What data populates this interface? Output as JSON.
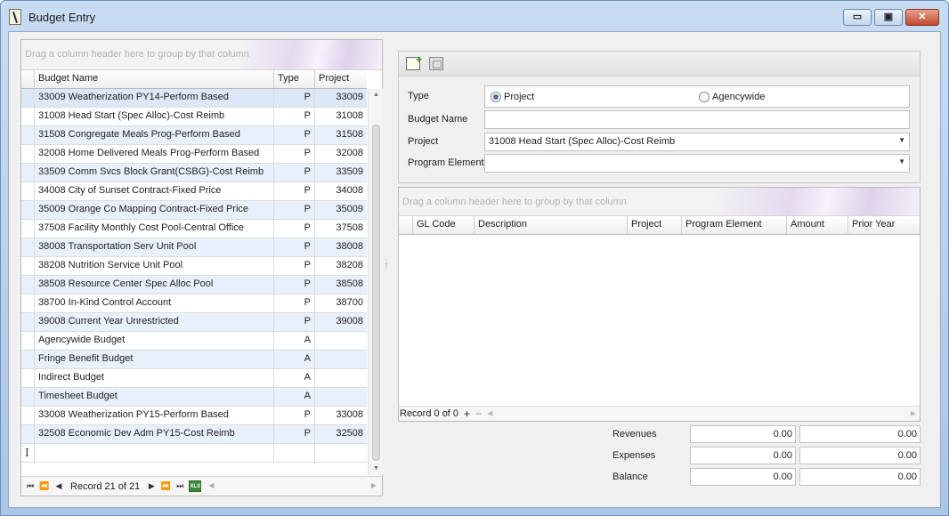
{
  "window": {
    "title": "Budget Entry",
    "buttons": {
      "minimize": "▭",
      "maximize": "▣",
      "close": "✕"
    }
  },
  "left_grid": {
    "group_hint": "Drag a column header here to group by that column",
    "columns": [
      "Budget Name",
      "Type",
      "Project"
    ],
    "rows": [
      {
        "name": "33009 Weatherization  PY14-Perform Based",
        "type": "P",
        "project": "33009"
      },
      {
        "name": "31008 Head Start (Spec Alloc)-Cost Reimb",
        "type": "P",
        "project": "31008"
      },
      {
        "name": "31508 Congregate Meals Prog-Perform Based",
        "type": "P",
        "project": "31508"
      },
      {
        "name": "32008 Home Delivered Meals Prog-Perform Based",
        "type": "P",
        "project": "32008"
      },
      {
        "name": "33509 Comm Svcs Block Grant(CSBG)-Cost Reimb",
        "type": "P",
        "project": "33509"
      },
      {
        "name": "34008 City of Sunset Contract-Fixed Price",
        "type": "P",
        "project": "34008"
      },
      {
        "name": "35009 Orange Co Mapping Contract-Fixed Price",
        "type": "P",
        "project": "35009"
      },
      {
        "name": "37508 Facility Monthly Cost Pool-Central Office",
        "type": "P",
        "project": "37508"
      },
      {
        "name": "38008 Transportation Serv Unit Pool",
        "type": "P",
        "project": "38008"
      },
      {
        "name": "38208 Nutrition Service Unit Pool",
        "type": "P",
        "project": "38208"
      },
      {
        "name": "38508 Resource Center Spec Alloc Pool",
        "type": "P",
        "project": "38508"
      },
      {
        "name": "38700 In-Kind Control Account",
        "type": "P",
        "project": "38700"
      },
      {
        "name": "39008 Current Year Unrestricted",
        "type": "P",
        "project": "39008"
      },
      {
        "name": "Agencywide Budget",
        "type": "A",
        "project": ""
      },
      {
        "name": "Fringe Benefit Budget",
        "type": "A",
        "project": ""
      },
      {
        "name": "Indirect Budget",
        "type": "A",
        "project": ""
      },
      {
        "name": "Timesheet Budget",
        "type": "A",
        "project": ""
      },
      {
        "name": "33008 Weatherization PY15-Perform Based",
        "type": "P",
        "project": "33008"
      },
      {
        "name": "32508 Economic Dev Adm PY15-Cost Reimb",
        "type": "P",
        "project": "32508"
      }
    ],
    "navigator": {
      "record_text": "Record 21 of 21",
      "first": "⏮",
      "prev_page": "⏪",
      "prev": "◀",
      "next": "▶",
      "next_page": "⏩",
      "last": "⏭",
      "export_label": "XLS"
    }
  },
  "form": {
    "type_label": "Type",
    "type_options": [
      "Project",
      "Agencywide"
    ],
    "type_selected": "Project",
    "budget_name_label": "Budget Name",
    "budget_name_value": "",
    "project_label": "Project",
    "project_value": "31008 Head Start (Spec Alloc)-Cost Reimb",
    "program_element_label": "Program Element",
    "program_element_value": ""
  },
  "detail_grid": {
    "group_hint": "Drag a column header here to group by that column",
    "columns": [
      "GL Code",
      "Description",
      "Project",
      "Program Element",
      "Amount",
      "Prior Year"
    ],
    "record_text": "Record 0 of 0",
    "add_symbol": "+",
    "remove_symbol": "−"
  },
  "totals": {
    "revenues_label": "Revenues",
    "revenues_current": "0.00",
    "revenues_prior": "0.00",
    "expenses_label": "Expenses",
    "expenses_current": "0.00",
    "expenses_prior": "0.00",
    "balance_label": "Balance",
    "balance_current": "0.00",
    "balance_prior": "0.00"
  }
}
